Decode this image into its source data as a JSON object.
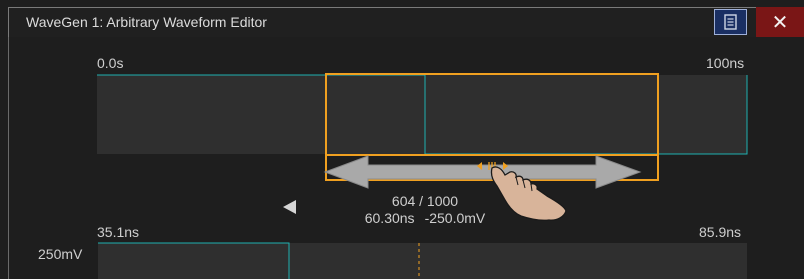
{
  "window": {
    "title": "WaveGen 1: Arbitrary Waveform Editor"
  },
  "icons": {
    "menu": "menu-icon",
    "close": "close-icon",
    "left_arrow": "left-arrow-icon",
    "pan_hand": "pan-hand-icon",
    "pan_arrows": "double-arrow-icon",
    "grip": "grip-handle-icon"
  },
  "overview": {
    "time_start": "0.0s",
    "time_end": "100ns"
  },
  "detail": {
    "time_start": "35.1ns",
    "time_end": "85.9ns",
    "volt_label": "250mV"
  },
  "cursor": {
    "point": "604 / 1000",
    "time": "60.30ns",
    "voltage": "-250.0mV"
  },
  "colors": {
    "accent": "#f0a020",
    "trace": "#1fb0b0",
    "close": "#7a1616",
    "menu": "#1a2f63"
  }
}
